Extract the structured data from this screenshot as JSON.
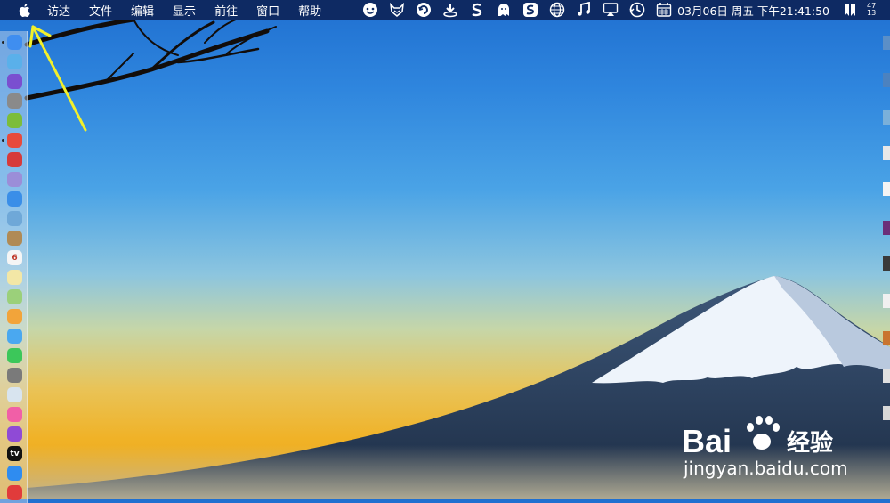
{
  "menubar": {
    "items": [
      "访达",
      "文件",
      "编辑",
      "显示",
      "前往",
      "窗口",
      "帮助"
    ],
    "status_icons": [
      "face-icon",
      "fox-icon",
      "sync-icon",
      "download-icon",
      "s-app-icon",
      "ghost-icon",
      "sogou-icon",
      "globe-icon",
      "music-note-icon",
      "airplay-icon",
      "time-machine-icon",
      "calendar-icon"
    ],
    "clock": "03月06日 周五 下午21:41:50",
    "right_icons": [
      "bookmark-icon",
      "battery-icon"
    ],
    "battery_text": [
      "47",
      "13"
    ]
  },
  "dock": {
    "items": [
      {
        "name": "finder-icon",
        "color": "#3f8ef0"
      },
      {
        "name": "safari-compass-icon",
        "color": "#5ab0ea"
      },
      {
        "name": "siri-icon",
        "color": "#7a4fd0"
      },
      {
        "name": "launchpad-rocket-icon",
        "color": "#8a8a8a"
      },
      {
        "name": "android-icon",
        "color": "#7cbd3a"
      },
      {
        "name": "chrome-icon",
        "color": "#e84a3b"
      },
      {
        "name": "toolbox-icon",
        "color": "#d63a3a"
      },
      {
        "name": "storage-icon",
        "color": "#9b8ed8"
      },
      {
        "name": "safari-icon",
        "color": "#3a8ee8"
      },
      {
        "name": "preview-icon",
        "color": "#6fa8d8"
      },
      {
        "name": "notes-book-icon",
        "color": "#b08a55"
      },
      {
        "name": "calendar-icon",
        "color": "#f5f5f5",
        "label": "6"
      },
      {
        "name": "stickies-icon",
        "color": "#f3e7a6"
      },
      {
        "name": "maps-icon",
        "color": "#9bd07a"
      },
      {
        "name": "photos-icon",
        "color": "#f2a43a"
      },
      {
        "name": "messages-icon",
        "color": "#4aa8f0"
      },
      {
        "name": "facetime-icon",
        "color": "#3cc75a"
      },
      {
        "name": "system-preferences-icon",
        "color": "#7a7a7a"
      },
      {
        "name": "screen-recorder-icon",
        "color": "#d8e4ef"
      },
      {
        "name": "itunes-icon",
        "color": "#f15fa7"
      },
      {
        "name": "podcasts-icon",
        "color": "#8f4ad6"
      },
      {
        "name": "apple-tv-icon",
        "color": "#111111",
        "label": "tv"
      },
      {
        "name": "app-store-icon",
        "color": "#2f8cf0"
      },
      {
        "name": "vivaldi-icon",
        "color": "#e13b3b"
      }
    ]
  },
  "watermark": {
    "brand": "Bai",
    "brand_cn": "经验",
    "url": "jingyan.baidu.com"
  }
}
